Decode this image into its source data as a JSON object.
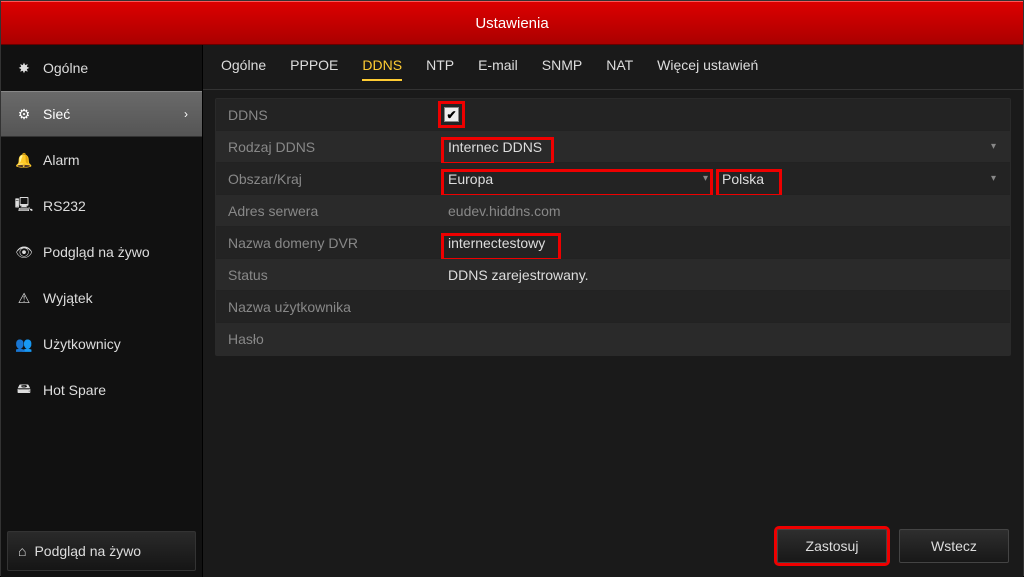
{
  "title": "Ustawienia",
  "sidebar": {
    "items": [
      {
        "label": "Ogólne",
        "icon": "✸"
      },
      {
        "label": "Sieć",
        "icon": "⚙",
        "active": true
      },
      {
        "label": "Alarm",
        "icon": "🔔"
      },
      {
        "label": "RS232",
        "icon": "🖳"
      },
      {
        "label": "Podgląd na żywo",
        "icon": "👁"
      },
      {
        "label": "Wyjątek",
        "icon": "⚠"
      },
      {
        "label": "Użytkownicy",
        "icon": "👥"
      },
      {
        "label": "Hot Spare",
        "icon": "🖴"
      }
    ],
    "footer": {
      "label": "Podgląd na żywo",
      "icon": "⌂"
    }
  },
  "tabs": [
    "Ogólne",
    "PPPOE",
    "DDNS",
    "NTP",
    "E-mail",
    "SNMP",
    "NAT",
    "Więcej ustawień"
  ],
  "active_tab": "DDNS",
  "form": {
    "ddns_label": "DDNS",
    "ddns_checked": true,
    "type_label": "Rodzaj DDNS",
    "type_value": "Internec DDNS",
    "region_label": "Obszar/Kraj",
    "region_value": "Europa",
    "country_value": "Polska",
    "server_label": "Adres serwera",
    "server_value": "eudev.hiddns.com",
    "domain_label": "Nazwa domeny DVR",
    "domain_value": "internectestowy",
    "status_label": "Status",
    "status_value": "DDNS zarejestrowany.",
    "username_label": "Nazwa użytkownika",
    "username_value": "",
    "password_label": "Hasło",
    "password_value": ""
  },
  "buttons": {
    "apply": "Zastosuj",
    "back": "Wstecz"
  }
}
